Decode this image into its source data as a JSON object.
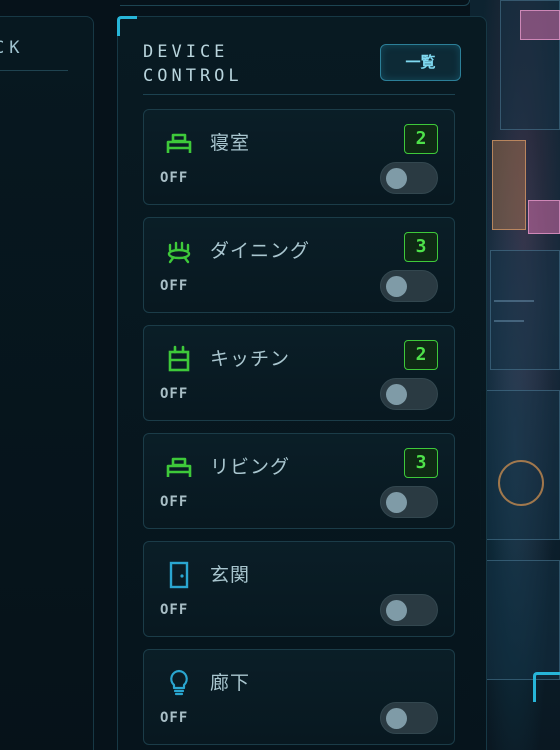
{
  "left_panel": {
    "title": "CK"
  },
  "device_control": {
    "title": "DEVICE\nCONTROL",
    "list_button": "一覧",
    "accent_color": "#27b5d8",
    "count_color": "#4ee24a"
  },
  "rooms": [
    {
      "name": "寝室",
      "status": "OFF",
      "count": "2",
      "icon": "bed-icon",
      "icon_color": "#3ec93a"
    },
    {
      "name": "ダイニング",
      "status": "OFF",
      "count": "3",
      "icon": "chandelier-icon",
      "icon_color": "#3ec93a"
    },
    {
      "name": "キッチン",
      "status": "OFF",
      "count": "2",
      "icon": "appliance-icon",
      "icon_color": "#3ec93a"
    },
    {
      "name": "リビング",
      "status": "OFF",
      "count": "3",
      "icon": "sofa-icon",
      "icon_color": "#3ec93a"
    },
    {
      "name": "玄関",
      "status": "OFF",
      "icon": "door-icon",
      "icon_color": "#2aa6d0"
    },
    {
      "name": "廊下",
      "status": "OFF",
      "icon": "lightbulb-icon",
      "icon_color": "#2aa6d0"
    }
  ]
}
